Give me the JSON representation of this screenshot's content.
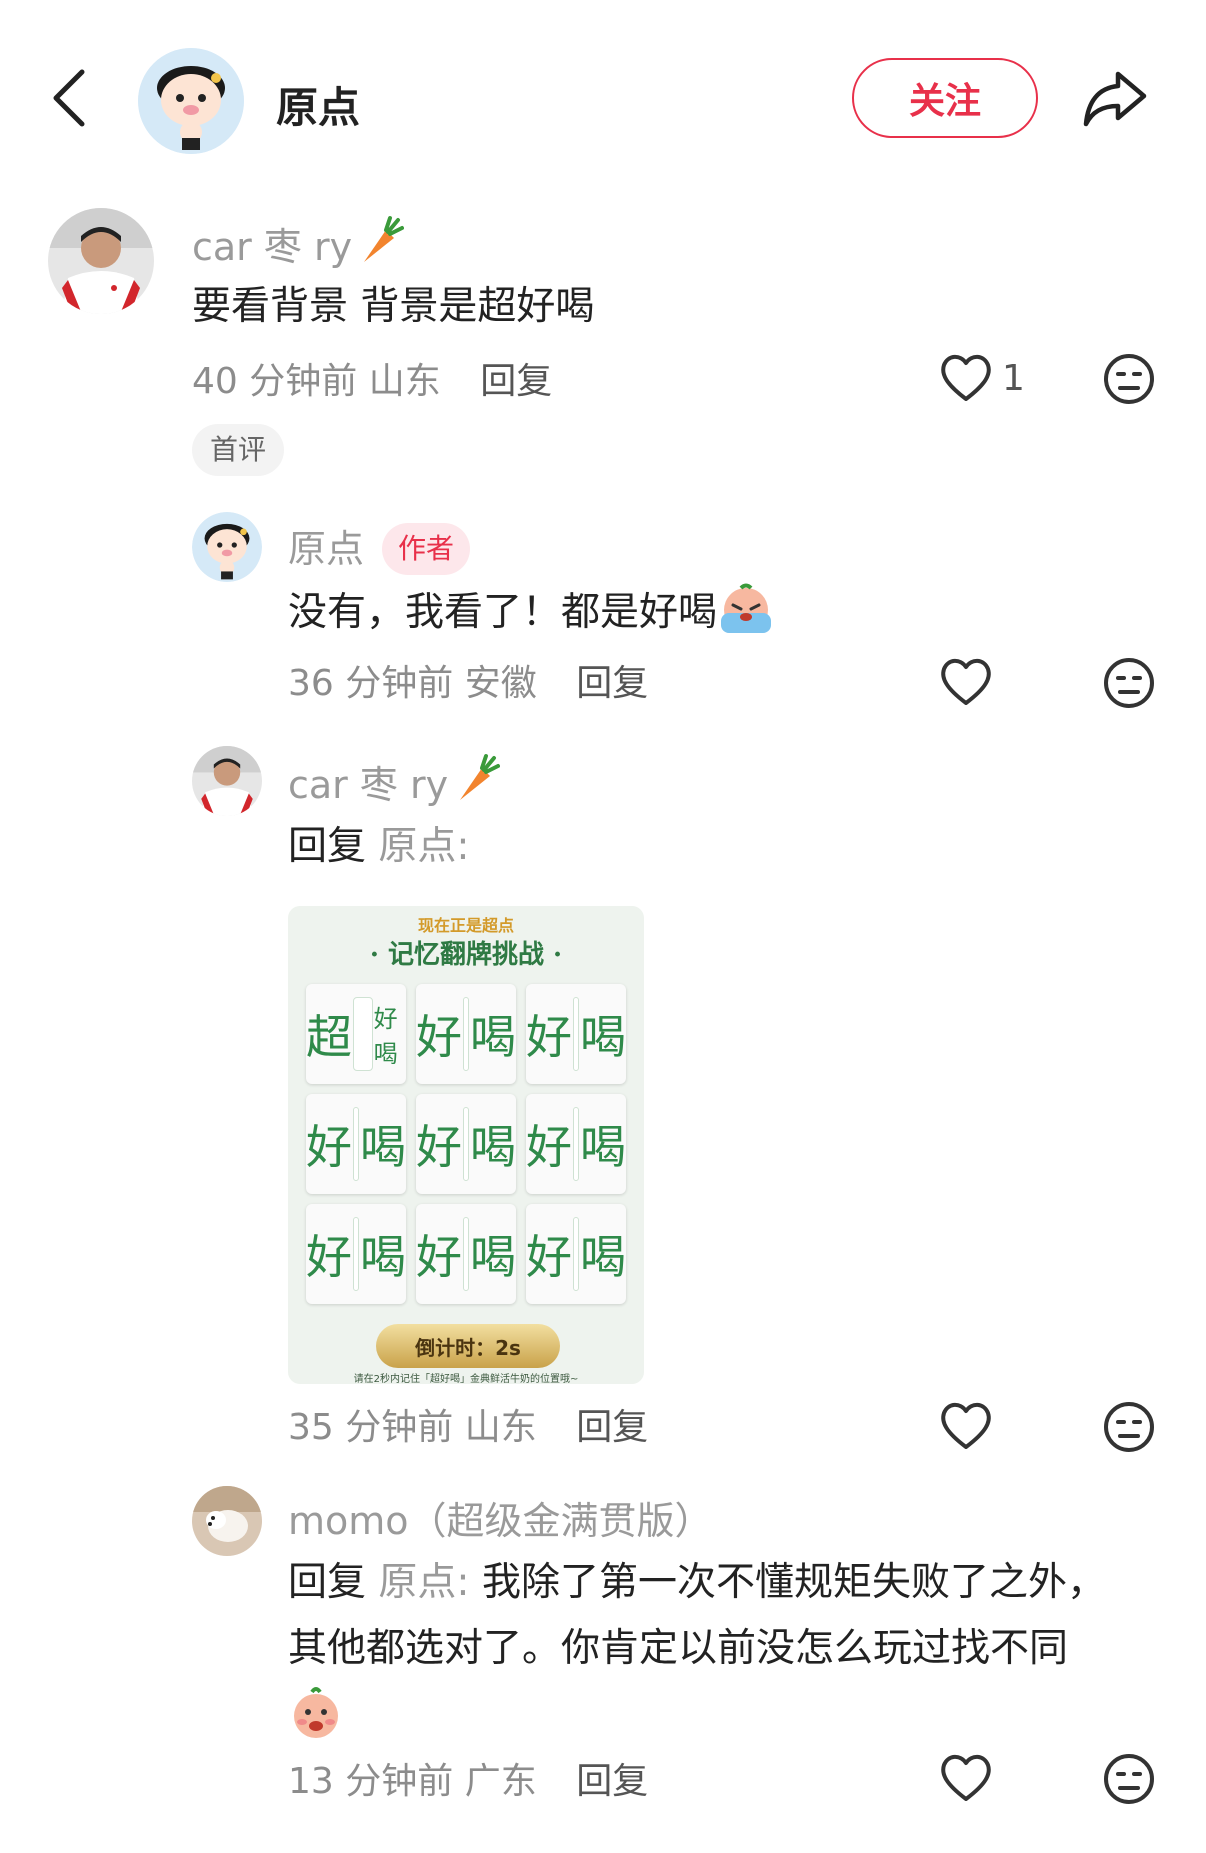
{
  "header": {
    "title": "原点",
    "follow_label": "关注"
  },
  "comments": [
    {
      "username": "car 枣 ry",
      "text": "要看背景 背景是超好喝",
      "time": "40 分钟前",
      "location": "山东",
      "reply_label": "回复",
      "likes": "1",
      "tag": "首评"
    },
    {
      "username": "原点",
      "author_badge": "作者",
      "text": "没有，我看了！都是好喝",
      "time": "36 分钟前",
      "location": "安徽",
      "reply_label": "回复"
    },
    {
      "username": "car 枣 ry",
      "reply_prefix": "回复",
      "reply_to": "原点:",
      "time": "35 分钟前",
      "location": "山东",
      "reply_label": "回复",
      "image": {
        "top_banner": "现在正是超点",
        "title": "· 记忆翻牌挑战 ·",
        "cells": [
          "超",
          "好喝",
          "好",
          "喝",
          "好",
          "喝",
          "好",
          "喝",
          "好",
          "喝",
          "好",
          "喝",
          "好",
          "喝",
          "好",
          "喝",
          "好",
          "喝"
        ],
        "timer": "倒计时：2s",
        "caption": "请在2秒内记住「超好喝」金典鲜活牛奶的位置哦~"
      }
    },
    {
      "username": "momo（超级金满贯版）",
      "reply_prefix": "回复",
      "reply_to": "原点:",
      "text_line1": "我除了第一次不懂规矩失败了之外，",
      "text_line2": "其他都选对了。你肯定以前没怎么玩过找不同",
      "time": "13 分钟前",
      "location": "广东",
      "reply_label": "回复"
    }
  ],
  "colors": {
    "accent": "#e8304a",
    "grey_text": "#9a9a9a",
    "body_text": "#222222"
  },
  "icons": [
    "back-arrow-icon",
    "share-icon",
    "heart-icon",
    "dislike-face-icon",
    "carrot-emoji-icon",
    "crying-emoji-icon",
    "shy-emoji-icon"
  ]
}
